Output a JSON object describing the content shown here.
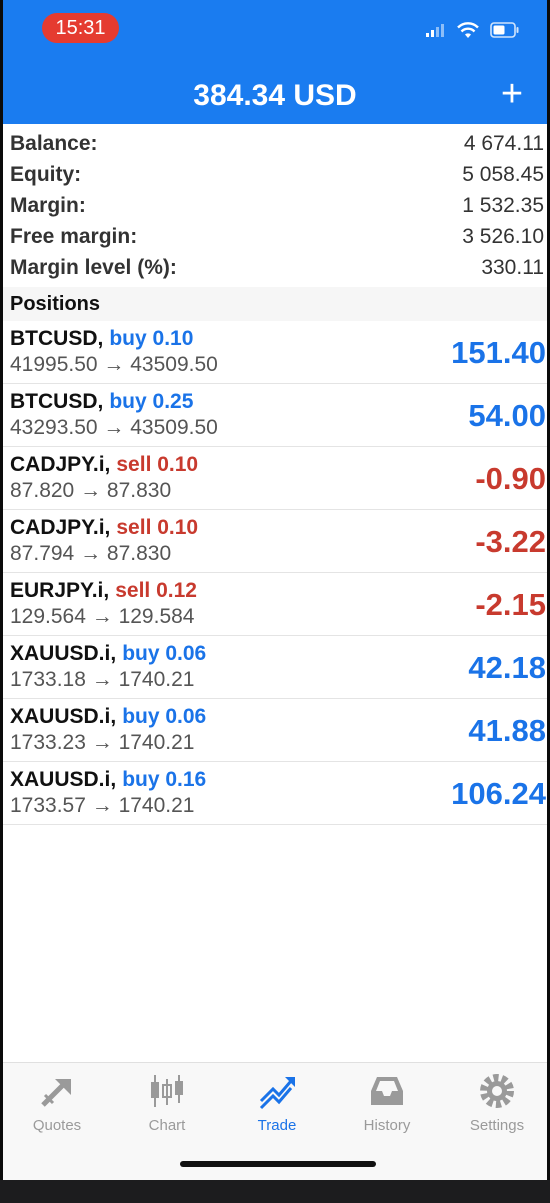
{
  "status_bar": {
    "time": "15:31"
  },
  "header": {
    "title": "384.34 USD",
    "add_label": "+"
  },
  "summary": [
    {
      "label": "Balance:",
      "value": "4 674.11"
    },
    {
      "label": "Equity:",
      "value": "5 058.45"
    },
    {
      "label": "Margin:",
      "value": "1 532.35"
    },
    {
      "label": "Free margin:",
      "value": "3 526.10"
    },
    {
      "label": "Margin level (%):",
      "value": "330.11"
    }
  ],
  "positions_title": "Positions",
  "positions": [
    {
      "symbol": "BTCUSD,",
      "side": "buy 0.10",
      "type": "buy",
      "prices": "41995.50 → 43509.50",
      "profit": "151.40"
    },
    {
      "symbol": "BTCUSD,",
      "side": "buy 0.25",
      "type": "buy",
      "prices": "43293.50 → 43509.50",
      "profit": "54.00"
    },
    {
      "symbol": "CADJPY.i,",
      "side": "sell 0.10",
      "type": "sell",
      "prices": "87.820 → 87.830",
      "profit": "-0.90"
    },
    {
      "symbol": "CADJPY.i,",
      "side": "sell 0.10",
      "type": "sell",
      "prices": "87.794 → 87.830",
      "profit": "-3.22"
    },
    {
      "symbol": "EURJPY.i,",
      "side": "sell 0.12",
      "type": "sell",
      "prices": "129.564 → 129.584",
      "profit": "-2.15"
    },
    {
      "symbol": "XAUUSD.i,",
      "side": "buy 0.06",
      "type": "buy",
      "prices": "1733.18 → 1740.21",
      "profit": "42.18"
    },
    {
      "symbol": "XAUUSD.i,",
      "side": "buy 0.06",
      "type": "buy",
      "prices": "1733.23 → 1740.21",
      "profit": "41.88"
    },
    {
      "symbol": "XAUUSD.i,",
      "side": "buy 0.16",
      "type": "buy",
      "prices": "1733.57 → 1740.21",
      "profit": "106.24"
    }
  ],
  "tabs": [
    {
      "label": "Quotes",
      "icon": "quotes-icon"
    },
    {
      "label": "Chart",
      "icon": "chart-icon"
    },
    {
      "label": "Trade",
      "icon": "trade-icon",
      "active": true
    },
    {
      "label": "History",
      "icon": "history-icon"
    },
    {
      "label": "Settings",
      "icon": "settings-icon"
    }
  ],
  "colors": {
    "accent": "#1a7cf0",
    "buy": "#1a73e8",
    "sell": "#c83a2e",
    "status_pill": "#e53b30"
  }
}
